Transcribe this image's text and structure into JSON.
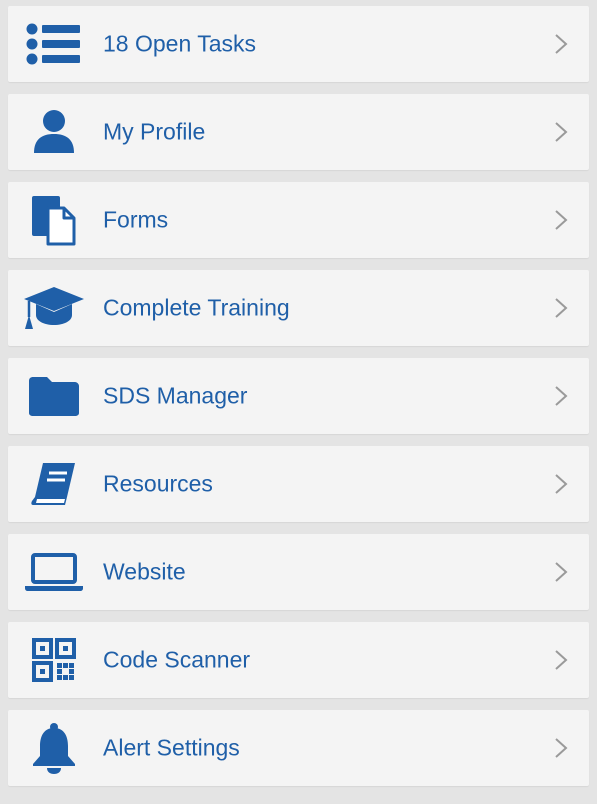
{
  "colors": {
    "accent": "#1f5fa8",
    "chevron": "#9a9a9a",
    "item_background": "#f4f4f4",
    "page_background": "#e4e4e4"
  },
  "menu": {
    "items": [
      {
        "label": "18 Open Tasks",
        "icon": "list-icon"
      },
      {
        "label": "My Profile",
        "icon": "user-icon"
      },
      {
        "label": "Forms",
        "icon": "documents-icon"
      },
      {
        "label": "Complete Training",
        "icon": "graduation-cap-icon"
      },
      {
        "label": "SDS Manager",
        "icon": "folder-icon"
      },
      {
        "label": "Resources",
        "icon": "book-icon"
      },
      {
        "label": "Website",
        "icon": "laptop-icon"
      },
      {
        "label": "Code Scanner",
        "icon": "qr-code-icon"
      },
      {
        "label": "Alert Settings",
        "icon": "bell-icon"
      }
    ]
  }
}
